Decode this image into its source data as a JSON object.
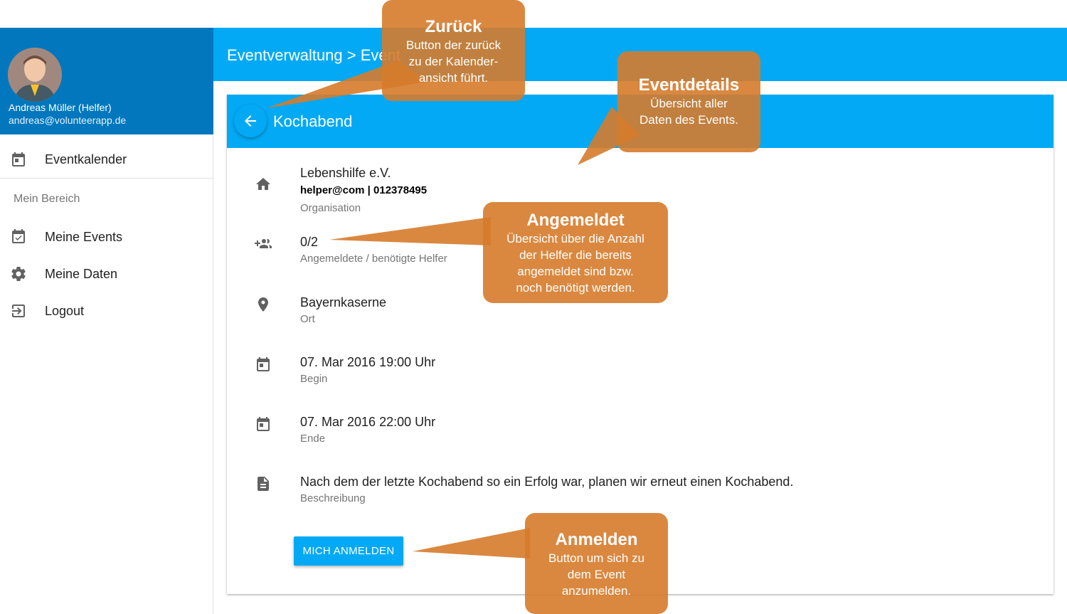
{
  "user": {
    "name": "Andreas Müller (Helfer)",
    "email": "andreas@volunteerapp.de"
  },
  "sidebar": {
    "calendar_label": "Eventkalender",
    "section_header": "Mein Bereich",
    "items": [
      {
        "label": "Meine Events",
        "icon": "calendar-check-icon"
      },
      {
        "label": "Meine Daten",
        "icon": "gear-icon"
      },
      {
        "label": "Logout",
        "icon": "logout-icon"
      }
    ]
  },
  "topbar": {
    "breadcrumb": "Eventverwaltung > Event"
  },
  "event": {
    "title": "Kochabend",
    "organisation": {
      "name": "Lebenshilfe e.V.",
      "contact": "helper@com | 012378495",
      "label": "Organisation"
    },
    "helpers": {
      "value": "0/2",
      "label": "Angemeldete / benötigte Helfer"
    },
    "location": {
      "value": "Bayernkaserne",
      "label": "Ort"
    },
    "begin": {
      "value": "07. Mar 2016 19:00 Uhr",
      "label": "Begin"
    },
    "end": {
      "value": "07. Mar 2016 22:00 Uhr",
      "label": "Ende"
    },
    "description": {
      "value": "Nach dem der letzte Kochabend so ein Erfolg war, planen wir erneut einen Kochabend.",
      "label": "Beschreibung"
    },
    "signup_label": "MICH ANMELDEN"
  },
  "callouts": {
    "zurueck": {
      "title": "Zurück",
      "lines": [
        "Button der zurück",
        "zu der Kalender-",
        "ansicht führt."
      ]
    },
    "eventdetails": {
      "title": "Eventdetails",
      "lines": [
        "Übersicht aller",
        "Daten des Events."
      ]
    },
    "angemeldet": {
      "title": "Angemeldet",
      "lines": [
        "Übersicht über die Anzahl",
        "der Helfer die bereits",
        "angemeldet sind bzw.",
        "noch benötigt werden."
      ]
    },
    "anmelden": {
      "title": "Anmelden",
      "lines": [
        "Button um sich zu",
        "dem Event",
        "anzumelden."
      ]
    }
  },
  "colors": {
    "primary": "#03a9f4",
    "primary_dark": "#0277bd",
    "callout": "#d67b2b"
  }
}
